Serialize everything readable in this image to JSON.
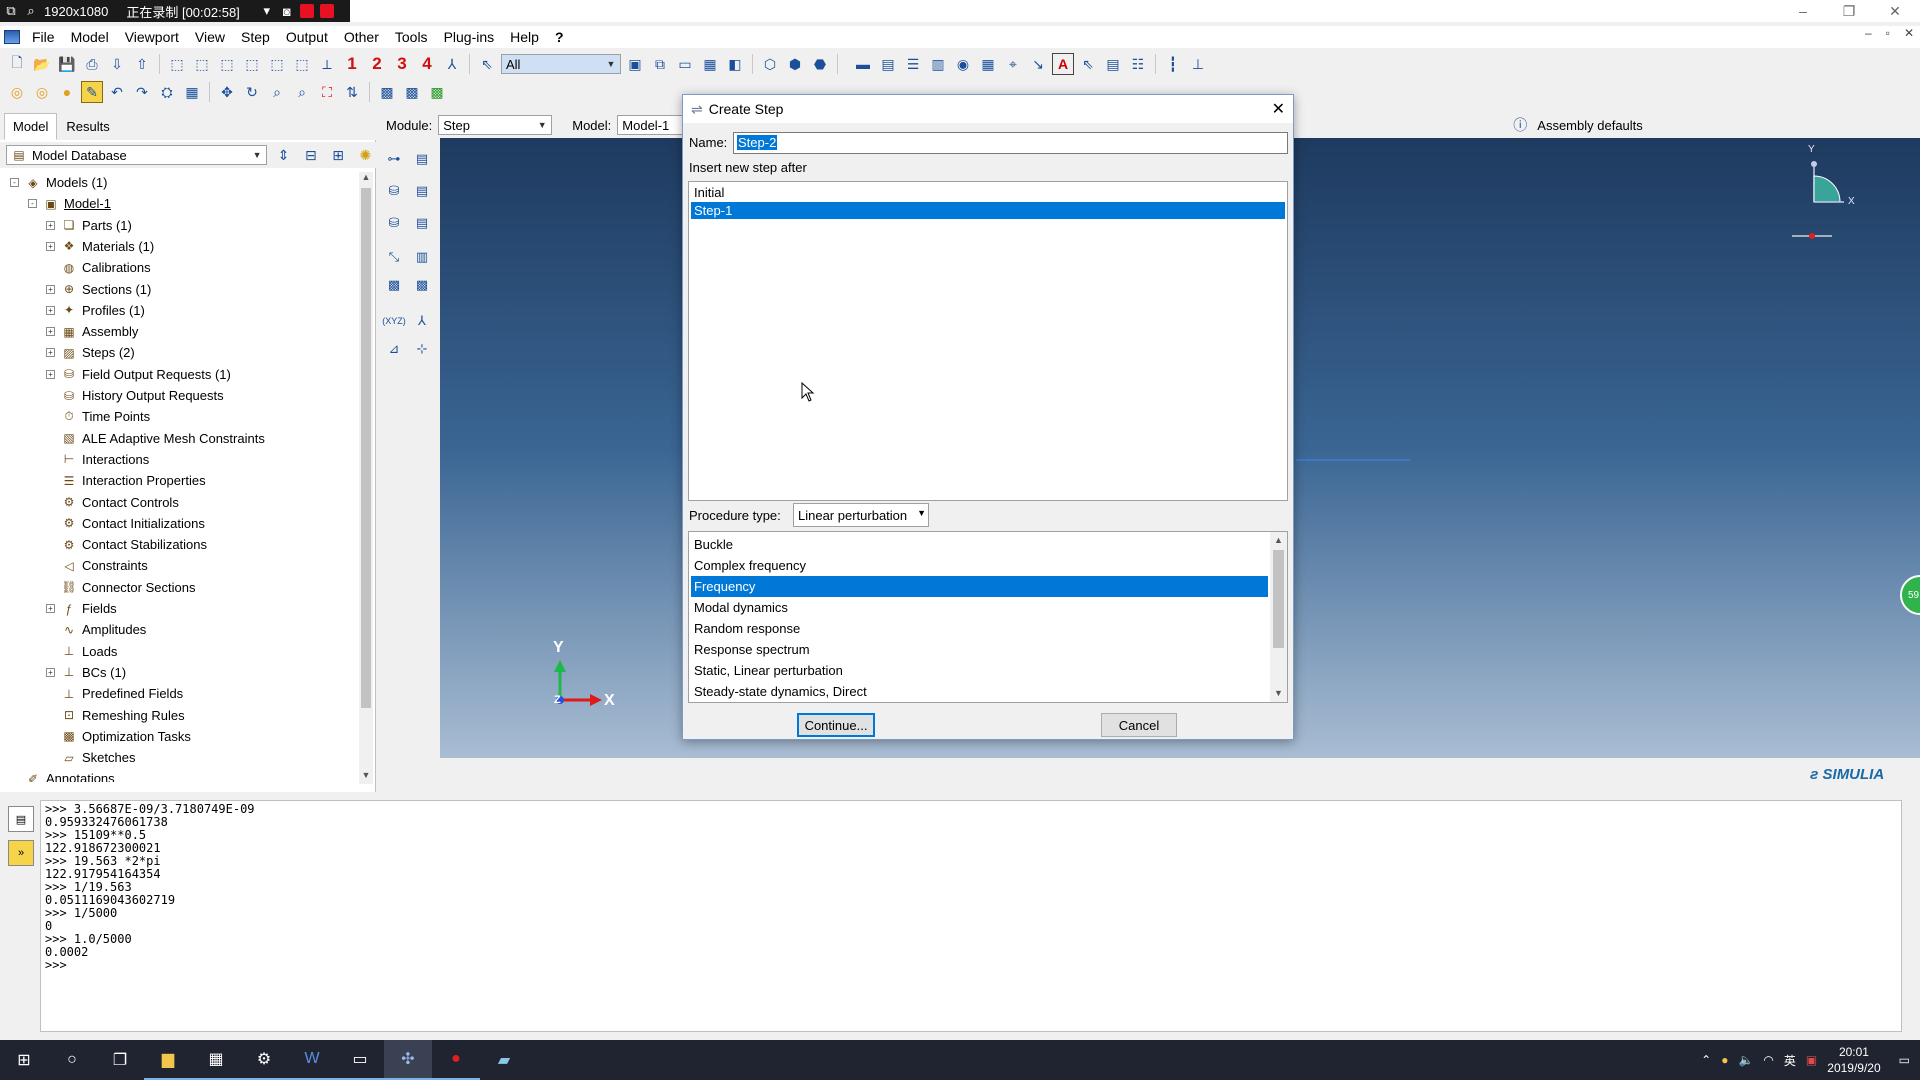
{
  "recording": {
    "resolution": "1920x1080",
    "status": "正在录制 [00:02:58]"
  },
  "menu": [
    "File",
    "Model",
    "Viewport",
    "View",
    "Step",
    "Output",
    "Other",
    "Tools",
    "Plug-ins",
    "Help",
    "?"
  ],
  "toolbar": {
    "step_numbers": [
      "1",
      "2",
      "3",
      "4"
    ],
    "selection_filter": "All",
    "assembly_defaults": "Assembly defaults"
  },
  "left_panel": {
    "tabs": [
      "Model",
      "Results"
    ],
    "database": "Model Database",
    "tree": [
      {
        "label": "Models (1)",
        "level": 0,
        "exp": "-"
      },
      {
        "label": "Model-1",
        "level": 1,
        "exp": "-"
      },
      {
        "label": "Parts (1)",
        "level": 2,
        "exp": "+"
      },
      {
        "label": "Materials (1)",
        "level": 2,
        "exp": "+"
      },
      {
        "label": "Calibrations",
        "level": 2,
        "exp": ""
      },
      {
        "label": "Sections (1)",
        "level": 2,
        "exp": "+"
      },
      {
        "label": "Profiles (1)",
        "level": 2,
        "exp": "+"
      },
      {
        "label": "Assembly",
        "level": 2,
        "exp": "+"
      },
      {
        "label": "Steps (2)",
        "level": 2,
        "exp": "+"
      },
      {
        "label": "Field Output Requests (1)",
        "level": 2,
        "exp": "+"
      },
      {
        "label": "History Output Requests",
        "level": 2,
        "exp": ""
      },
      {
        "label": "Time Points",
        "level": 2,
        "exp": ""
      },
      {
        "label": "ALE Adaptive Mesh Constraints",
        "level": 2,
        "exp": ""
      },
      {
        "label": "Interactions",
        "level": 2,
        "exp": ""
      },
      {
        "label": "Interaction Properties",
        "level": 2,
        "exp": ""
      },
      {
        "label": "Contact Controls",
        "level": 2,
        "exp": ""
      },
      {
        "label": "Contact Initializations",
        "level": 2,
        "exp": ""
      },
      {
        "label": "Contact Stabilizations",
        "level": 2,
        "exp": ""
      },
      {
        "label": "Constraints",
        "level": 2,
        "exp": ""
      },
      {
        "label": "Connector Sections",
        "level": 2,
        "exp": ""
      },
      {
        "label": "Fields",
        "level": 2,
        "exp": "+"
      },
      {
        "label": "Amplitudes",
        "level": 2,
        "exp": ""
      },
      {
        "label": "Loads",
        "level": 2,
        "exp": ""
      },
      {
        "label": "BCs (1)",
        "level": 2,
        "exp": "+"
      },
      {
        "label": "Predefined Fields",
        "level": 2,
        "exp": ""
      },
      {
        "label": "Remeshing Rules",
        "level": 2,
        "exp": ""
      },
      {
        "label": "Optimization Tasks",
        "level": 2,
        "exp": ""
      },
      {
        "label": "Sketches",
        "level": 2,
        "exp": ""
      },
      {
        "label": "Annotations",
        "level": 0,
        "exp": ""
      }
    ]
  },
  "module_bar": {
    "module_label": "Module:",
    "module_value": "Step",
    "model_label": "Model:",
    "model_value": "Model-1"
  },
  "viewport": {
    "triad_y": "Y",
    "triad_x": "X",
    "triad_z": "Z",
    "brand": "SIMULIA",
    "badge": "59"
  },
  "dialog": {
    "title": "Create Step",
    "name_label": "Name:",
    "name_value": "Step-2",
    "insert_label": "Insert new step after",
    "steps": [
      "Initial",
      "Step-1"
    ],
    "selected_step": 1,
    "procedure_label": "Procedure type:",
    "procedure_value": "Linear perturbation",
    "procedures": [
      "Buckle",
      "Complex frequency",
      "Frequency",
      "Modal dynamics",
      "Random response",
      "Response spectrum",
      "Static, Linear perturbation",
      "Steady-state dynamics, Direct"
    ],
    "selected_procedure": 2,
    "continue_label": "Continue...",
    "cancel_label": "Cancel"
  },
  "console": {
    "text": ">>> 3.56687E-09/3.7180749E-09\n0.959332476061738\n>>> 15109**0.5\n122.918672300021\n>>> 19.563 *2*pi\n122.917954164354\n>>> 1/19.563\n0.0511169043602719\n>>> 1/5000\n0\n>>> 1.0/5000\n0.0002\n>>>"
  },
  "taskbar": {
    "time": "20:01",
    "date": "2019/9/20",
    "ime": "英"
  }
}
